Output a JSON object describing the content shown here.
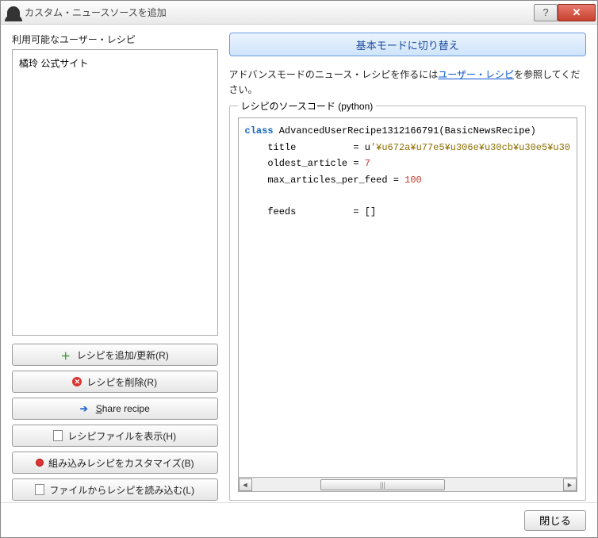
{
  "window": {
    "title": "カスタム・ニュースソースを追加"
  },
  "left": {
    "label": "利用可能なユーザー・レシピ",
    "items": [
      "橘玲 公式サイト"
    ],
    "buttons": {
      "add": "レシピを追加/更新(R)",
      "delete": "レシピを削除(R)",
      "share": "Share recipe",
      "showfile": "レシピファイルを表示(H)",
      "customize": "組み込みレシピをカスタマイズ(B)",
      "load": "ファイルからレシピを読み込む(L)"
    }
  },
  "right": {
    "switch_mode": "基本モードに切り替え",
    "info_pre": "アドバンスモードのニュース・レシピを作るには",
    "info_link": "ユーザー・レシピ",
    "info_post": "を参照してください。",
    "legend": "レシピのソースコード (python)",
    "code": {
      "classname": "AdvancedUserRecipe1312166791",
      "base": "BasicNewsRecipe",
      "title_val": "'¥u672a¥u77e5¥u306e¥u30cb¥u30e5¥u30",
      "oldest_article": 7,
      "max_articles_per_feed": 100,
      "feeds": "[]"
    }
  },
  "footer": {
    "close": "閉じる"
  }
}
